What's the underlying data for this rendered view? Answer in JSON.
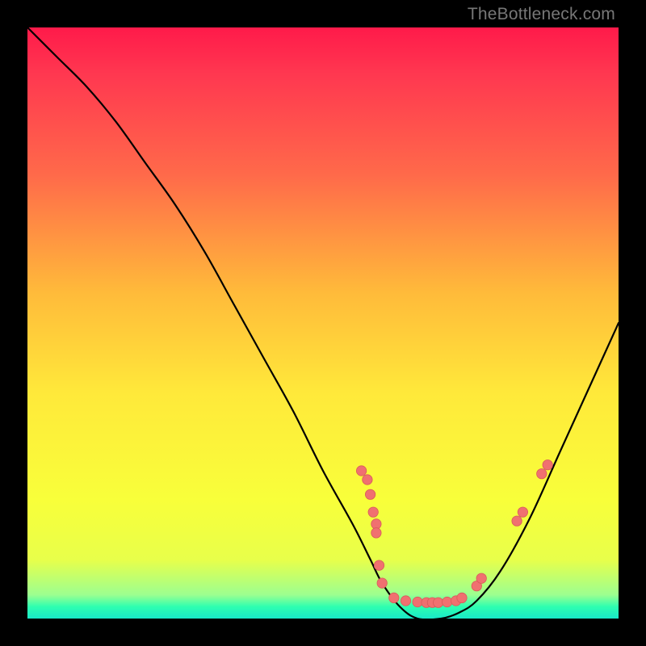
{
  "watermark": "TheBottleneck.com",
  "chart_data": {
    "type": "line",
    "title": "",
    "xlabel": "",
    "ylabel": "",
    "xlim": [
      0,
      100
    ],
    "ylim": [
      0,
      100
    ],
    "series": [
      {
        "name": "bottleneck-curve",
        "x": [
          0,
          5,
          10,
          15,
          20,
          25,
          30,
          35,
          40,
          45,
          50,
          55,
          58,
          60,
          63,
          66,
          70,
          73,
          76,
          80,
          85,
          90,
          95,
          100
        ],
        "y": [
          100,
          95,
          90,
          84,
          77,
          70,
          62,
          53,
          44,
          35,
          25,
          16,
          10,
          6,
          2,
          0,
          0,
          1,
          3,
          8,
          17,
          28,
          39,
          50
        ]
      }
    ],
    "markers": [
      {
        "x": 56.5,
        "y": 25.0
      },
      {
        "x": 57.5,
        "y": 23.5
      },
      {
        "x": 58.0,
        "y": 21.0
      },
      {
        "x": 58.5,
        "y": 18.0
      },
      {
        "x": 59.0,
        "y": 16.0
      },
      {
        "x": 59.0,
        "y": 14.5
      },
      {
        "x": 59.5,
        "y": 9.0
      },
      {
        "x": 60.0,
        "y": 6.0
      },
      {
        "x": 62.0,
        "y": 3.5
      },
      {
        "x": 64.0,
        "y": 3.0
      },
      {
        "x": 66.0,
        "y": 2.8
      },
      {
        "x": 67.5,
        "y": 2.7
      },
      {
        "x": 68.5,
        "y": 2.7
      },
      {
        "x": 69.5,
        "y": 2.7
      },
      {
        "x": 71.0,
        "y": 2.8
      },
      {
        "x": 72.5,
        "y": 3.0
      },
      {
        "x": 73.5,
        "y": 3.5
      },
      {
        "x": 76.0,
        "y": 5.5
      },
      {
        "x": 76.8,
        "y": 6.8
      },
      {
        "x": 82.8,
        "y": 16.5
      },
      {
        "x": 83.8,
        "y": 18.0
      },
      {
        "x": 87.0,
        "y": 24.5
      },
      {
        "x": 88.0,
        "y": 26.0
      }
    ],
    "colors": {
      "curve": "#000000",
      "marker_fill": "#f07070",
      "marker_stroke": "#d85a5a"
    }
  }
}
